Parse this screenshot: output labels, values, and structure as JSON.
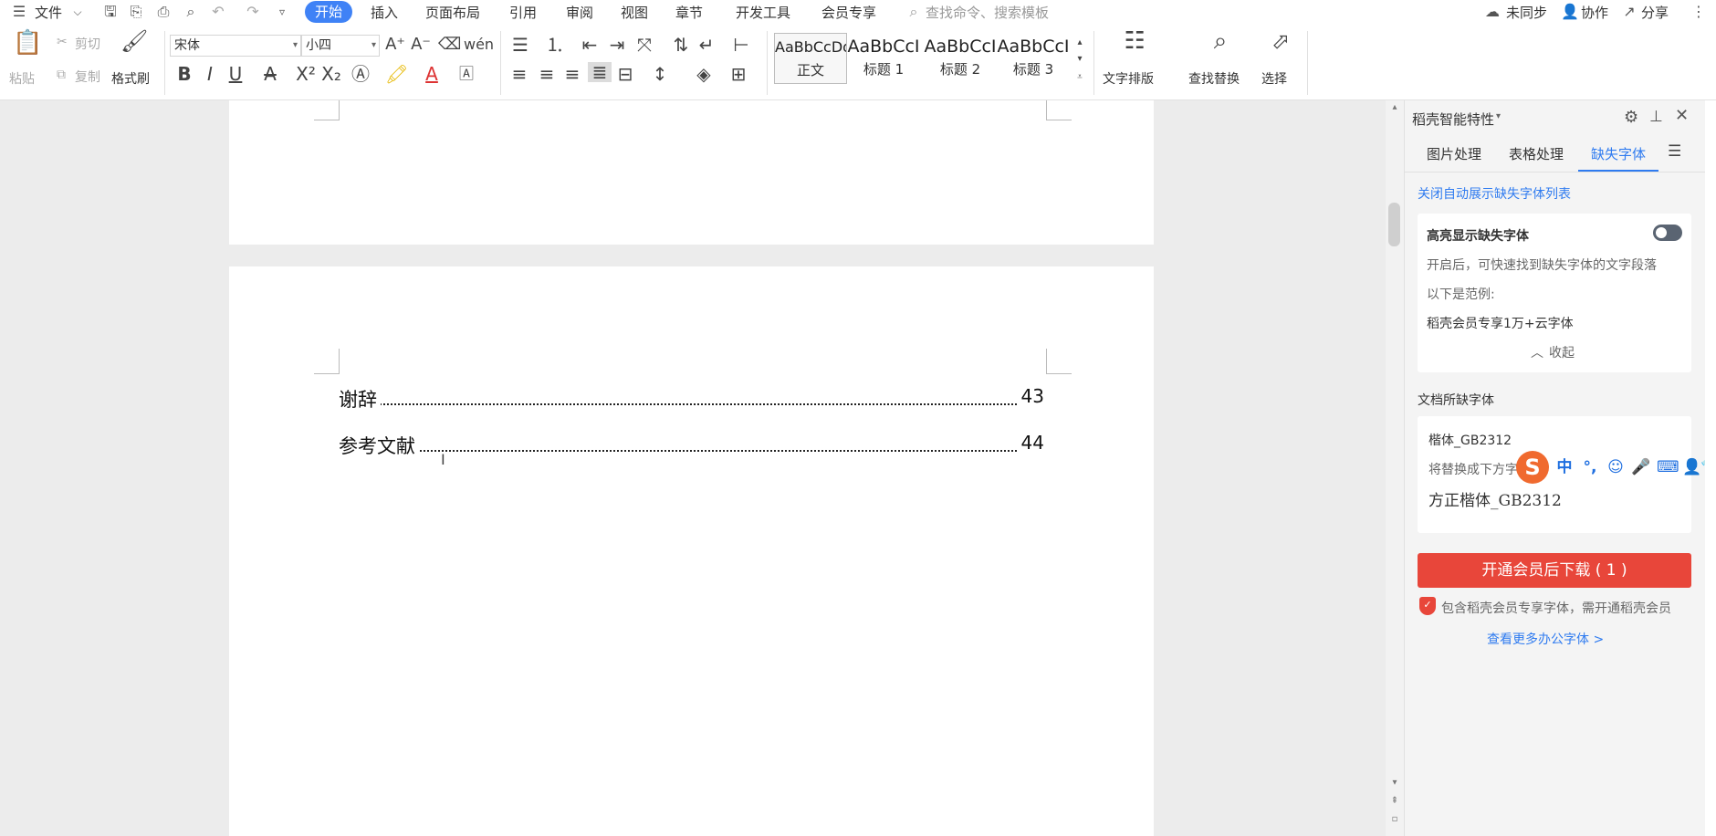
{
  "menubar": {
    "file_label": "文件",
    "tabs": [
      "开始",
      "插入",
      "页面布局",
      "引用",
      "审阅",
      "视图",
      "章节",
      "开发工具",
      "会员专享"
    ],
    "search_placeholder": "查找命令、搜索模板",
    "sync_label": "未同步",
    "collab_label": "协作",
    "share_label": "分享"
  },
  "ribbon": {
    "paste_label": "粘贴",
    "cut_label": "剪切",
    "copy_label": "复制",
    "format_painter_label": "格式刷",
    "font_name": "宋体",
    "font_size": "小四",
    "styles": [
      {
        "preview": "AaBbCcDd",
        "label": "正文"
      },
      {
        "preview": "AaBbCcI",
        "label": "标题 1"
      },
      {
        "preview": "AaBbCcI",
        "label": "标题 2"
      },
      {
        "preview": "AaBbCcI",
        "label": "标题 3"
      }
    ],
    "text_layout_label": "文字排版",
    "find_replace_label": "查找替换",
    "select_label": "选择"
  },
  "document": {
    "toc": [
      {
        "title": "谢辞",
        "page": "43"
      },
      {
        "title": "参考文献",
        "page": "44"
      }
    ]
  },
  "panel": {
    "title": "稻壳智能特性",
    "tabs": [
      "图片处理",
      "表格处理",
      "缺失字体"
    ],
    "close_auto_link": "关闭自动展示缺失字体列表",
    "highlight_card": {
      "title": "高亮显示缺失字体",
      "desc": "开启后，可快速找到缺失字体的文字段落",
      "example_label": "以下是范例:",
      "example_text": "稻壳会员专享1万+云字体",
      "collapse_label": "收起"
    },
    "missing_section_title": "文档所缺字体",
    "missing_font": {
      "name": "楷体_GB2312",
      "replace_hint": "将替换成下方字",
      "replacement": "方正楷体_GB2312"
    },
    "download_button": "开通会员后下载 ( 1 )",
    "member_notice": "包含稻壳会员专享字体，需开通稻壳会员",
    "more_fonts_link": "查看更多办公字体 >"
  },
  "ime": {
    "mode_label": "中",
    "punct_label": "°,"
  }
}
